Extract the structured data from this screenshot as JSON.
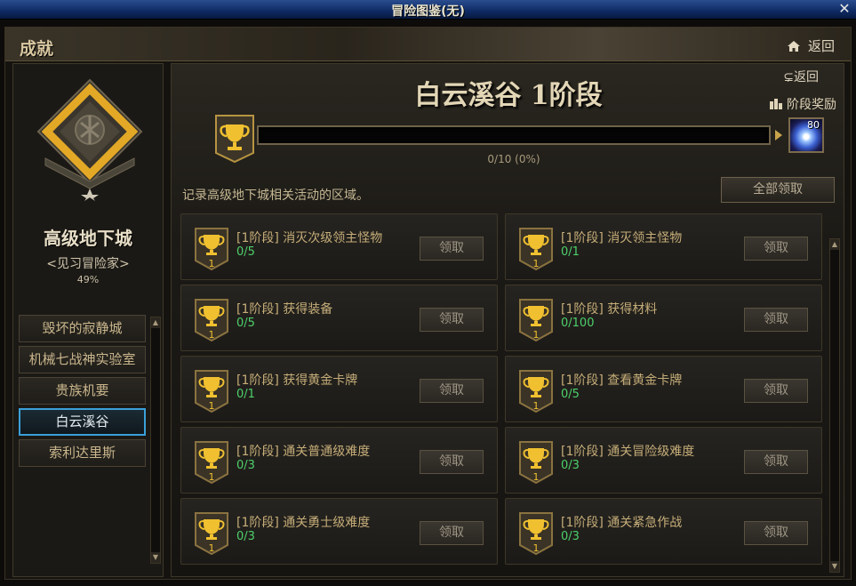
{
  "window": {
    "title": "冒险图鉴(无)",
    "close_glyph": "✕"
  },
  "header": {
    "heading": "成就",
    "back_label": "返回"
  },
  "left": {
    "title": "高级地下城",
    "rank": "<见习冒险家>",
    "percent": "49%",
    "nav": [
      {
        "label": "毁坏的寂静城"
      },
      {
        "label": "机械七战神实验室"
      },
      {
        "label": "贵族机要"
      },
      {
        "label": "白云溪谷",
        "active": true
      },
      {
        "label": "索利达里斯"
      }
    ]
  },
  "main": {
    "zone_title": "白云溪谷 1阶段",
    "back_label": "⊊返回",
    "stage_reward_label": "阶段奖励",
    "progress": {
      "text": "0/10 (0%)",
      "fraction": 0.0
    },
    "reward_level": "80",
    "description": "记录高级地下城相关活动的区域。",
    "claim_all_label": "全部领取",
    "claim_label": "领取",
    "cup_number": "1",
    "achievements": [
      {
        "label": "[1阶段] 消灭次级领主怪物",
        "count": "0/5"
      },
      {
        "label": "[1阶段] 消灭领主怪物",
        "count": "0/1"
      },
      {
        "label": "[1阶段] 获得装备",
        "count": "0/5"
      },
      {
        "label": "[1阶段] 获得材料",
        "count": "0/100"
      },
      {
        "label": "[1阶段] 获得黄金卡牌",
        "count": "0/1"
      },
      {
        "label": "[1阶段] 查看黄金卡牌",
        "count": "0/5"
      },
      {
        "label": "[1阶段] 通关普通级难度",
        "count": "0/3"
      },
      {
        "label": "[1阶段] 通关冒险级难度",
        "count": "0/3"
      },
      {
        "label": "[1阶段] 通关勇士级难度",
        "count": "0/3"
      },
      {
        "label": "[1阶段] 通关紧急作战",
        "count": "0/3"
      }
    ]
  },
  "colors": {
    "accent_gold": "#c59b2c",
    "progress_green": "#4dd06a",
    "active_blue": "#3aa0d8"
  }
}
